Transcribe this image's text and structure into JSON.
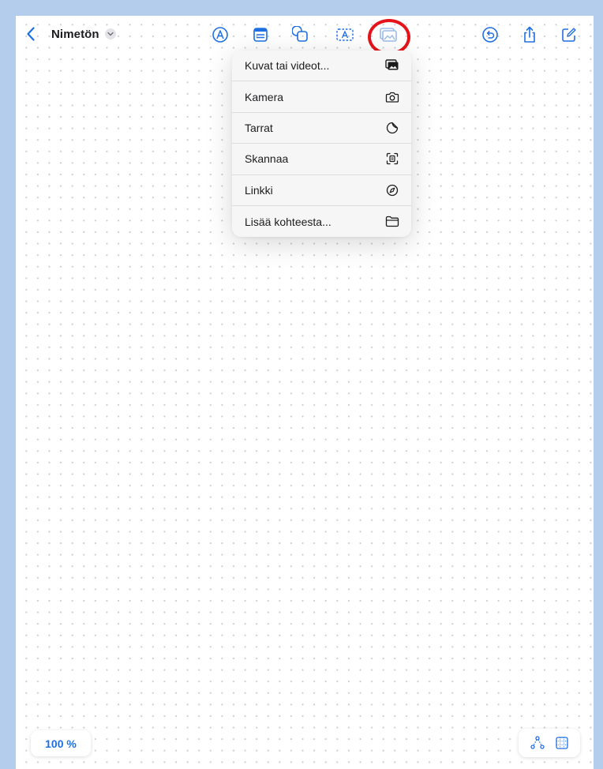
{
  "header": {
    "title": "Nimetön"
  },
  "menu": {
    "items": [
      {
        "label": "Kuvat tai videot...",
        "icon": "photo-library-icon"
      },
      {
        "label": "Kamera",
        "icon": "camera-icon"
      },
      {
        "label": "Tarrat",
        "icon": "sticker-icon"
      },
      {
        "label": "Skannaa",
        "icon": "scan-icon"
      },
      {
        "label": "Linkki",
        "icon": "compass-icon"
      },
      {
        "label": "Lisää kohteesta...",
        "icon": "folder-icon"
      }
    ]
  },
  "footer": {
    "zoom": "100 %"
  },
  "colors": {
    "accent": "#1f6fe0",
    "background": "#b4cdec",
    "highlight": "#e5141b"
  }
}
